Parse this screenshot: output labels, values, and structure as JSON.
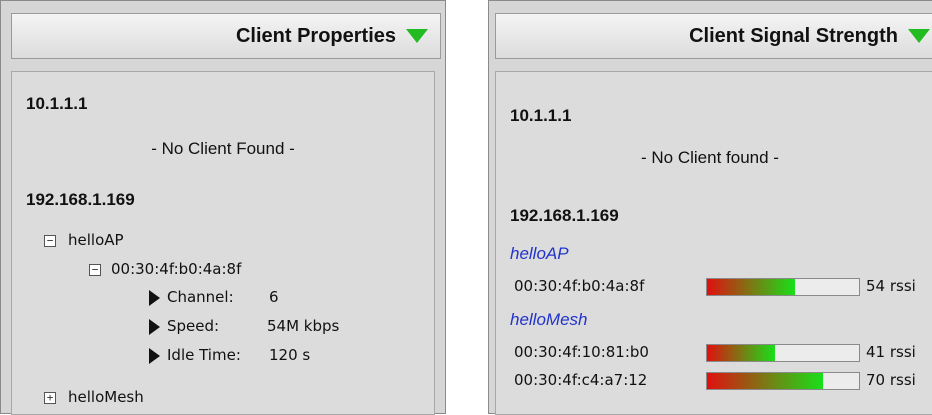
{
  "client_properties": {
    "title": "Client Properties",
    "ip1": "10.1.1.1",
    "no_client": "- No Client Found -",
    "ip2": "192.168.1.169",
    "ap1": {
      "name": "helloAP",
      "mac": "00:30:4f:b0:4a:8f",
      "channel_label": "Channel:",
      "channel_value": "6",
      "speed_label": "Speed:",
      "speed_value": "54M kbps",
      "idle_label": "Idle Time:",
      "idle_value": "120 s"
    },
    "ap2": {
      "name": "helloMesh"
    },
    "collapse_symbol": "−",
    "expand_symbol": "+"
  },
  "client_signal_strength": {
    "title": "Client Signal Strength",
    "ip1": "10.1.1.1",
    "no_client": "- No Client found -",
    "ip2": "192.168.1.169",
    "aps": [
      {
        "name": "helloAP",
        "clients": [
          {
            "mac": "00:30:4f:b0:4a:8f",
            "rssi": 54,
            "rssi_label": "54 rssi",
            "fill_fraction": 0.58
          }
        ]
      },
      {
        "name": "helloMesh",
        "clients": [
          {
            "mac": "00:30:4f:10:81:b0",
            "rssi": 41,
            "rssi_label": "41 rssi",
            "fill_fraction": 0.45
          },
          {
            "mac": "00:30:4f:c4:a7:12",
            "rssi": 70,
            "rssi_label": "70 rssi",
            "fill_fraction": 0.76
          }
        ]
      }
    ]
  },
  "colors": {
    "panel_bg": "#d6d6d6",
    "accent_triangle": "#22bb22",
    "ap_name": "#2233cc",
    "bar_low": "#e01010",
    "bar_high": "#18e018"
  }
}
